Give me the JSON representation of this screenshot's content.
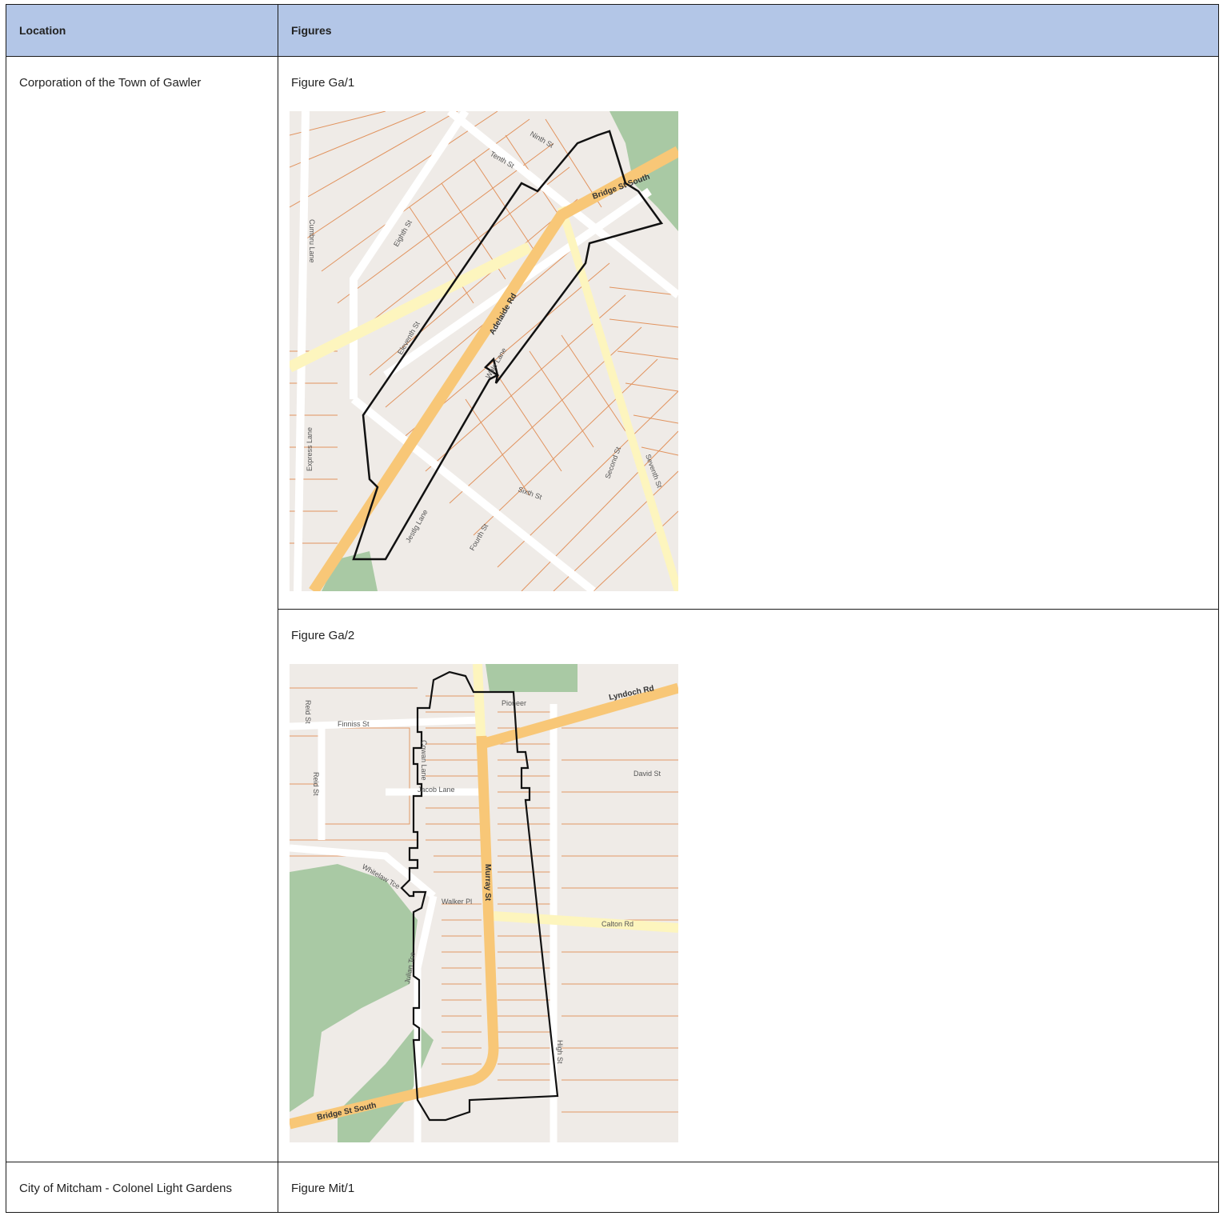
{
  "header": {
    "col_location": "Location",
    "col_figures": "Figures"
  },
  "rows": [
    {
      "location": "Corporation of the Town of Gawler",
      "figures": [
        {
          "label": "Figure Ga/1",
          "streets": [
            "Ninth St",
            "Tenth St",
            "Bridge St South",
            "Eighth St",
            "Adelaide Rd",
            "Eleventh St",
            "Wale Lane",
            "Express Lane",
            "Second St",
            "Seventh St",
            "Sixth St",
            "Fourth St",
            "Jestlg Lane",
            "Cumbru Lane"
          ]
        },
        {
          "label": "Figure Ga/2",
          "streets": [
            "Lyndoch Rd",
            "Reid St",
            "Finniss St",
            "Reid St",
            "Pioneer",
            "Jacob Lane",
            "David St",
            "Murray St",
            "Whitelaw Tce",
            "Walker Pl",
            "Calton Rd",
            "Julian Tce",
            "High St",
            "Bridge St South",
            "Cowan Lane"
          ]
        }
      ]
    },
    {
      "location": "City of Mitcham - Colonel Light Gardens",
      "figures": [
        {
          "label": "Figure Mit/1"
        }
      ]
    }
  ]
}
